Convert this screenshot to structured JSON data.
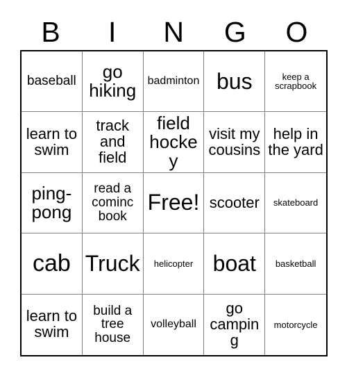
{
  "card": {
    "title": "Bingo Card",
    "header_letters": [
      "B",
      "I",
      "N",
      "G",
      "O"
    ],
    "columns": 5,
    "rows": 5,
    "colors": {
      "background": "#ffffff",
      "text": "#000000",
      "outer_border": "#000000",
      "inner_border": "#808080"
    },
    "free_space_index": 12,
    "cells": [
      {
        "text": "baseball",
        "size": "fs-md"
      },
      {
        "text": "go hiking",
        "size": "fs-xl"
      },
      {
        "text": "badminton",
        "size": "fs-sm"
      },
      {
        "text": "bus",
        "size": "fs-xxl"
      },
      {
        "text": "keep a scrapbook",
        "size": "fs-xs"
      },
      {
        "text": "learn to swim",
        "size": "fs-lg"
      },
      {
        "text": "track and field",
        "size": "fs-lg"
      },
      {
        "text": "field hockey",
        "size": "fs-xl"
      },
      {
        "text": "visit my cousins",
        "size": "fs-lg"
      },
      {
        "text": "help in the yard",
        "size": "fs-lg"
      },
      {
        "text": "ping-pong",
        "size": "fs-xl"
      },
      {
        "text": "read a cominc book",
        "size": "fs-md"
      },
      {
        "text": "Free!",
        "size": "fs-xxl"
      },
      {
        "text": "scooter",
        "size": "fs-lg"
      },
      {
        "text": "skateboard",
        "size": "fs-xs"
      },
      {
        "text": "cab",
        "size": "fs-huge"
      },
      {
        "text": "Truck",
        "size": "fs-xxl"
      },
      {
        "text": "helicopter",
        "size": "fs-xs"
      },
      {
        "text": "boat",
        "size": "fs-xxl"
      },
      {
        "text": "basketball",
        "size": "fs-xs"
      },
      {
        "text": "learn to swim",
        "size": "fs-lg"
      },
      {
        "text": "build a tree house",
        "size": "fs-md"
      },
      {
        "text": "volleyball",
        "size": "fs-sm"
      },
      {
        "text": "go camping",
        "size": "fs-lg"
      },
      {
        "text": "motorcycle",
        "size": "fs-xs"
      }
    ]
  }
}
